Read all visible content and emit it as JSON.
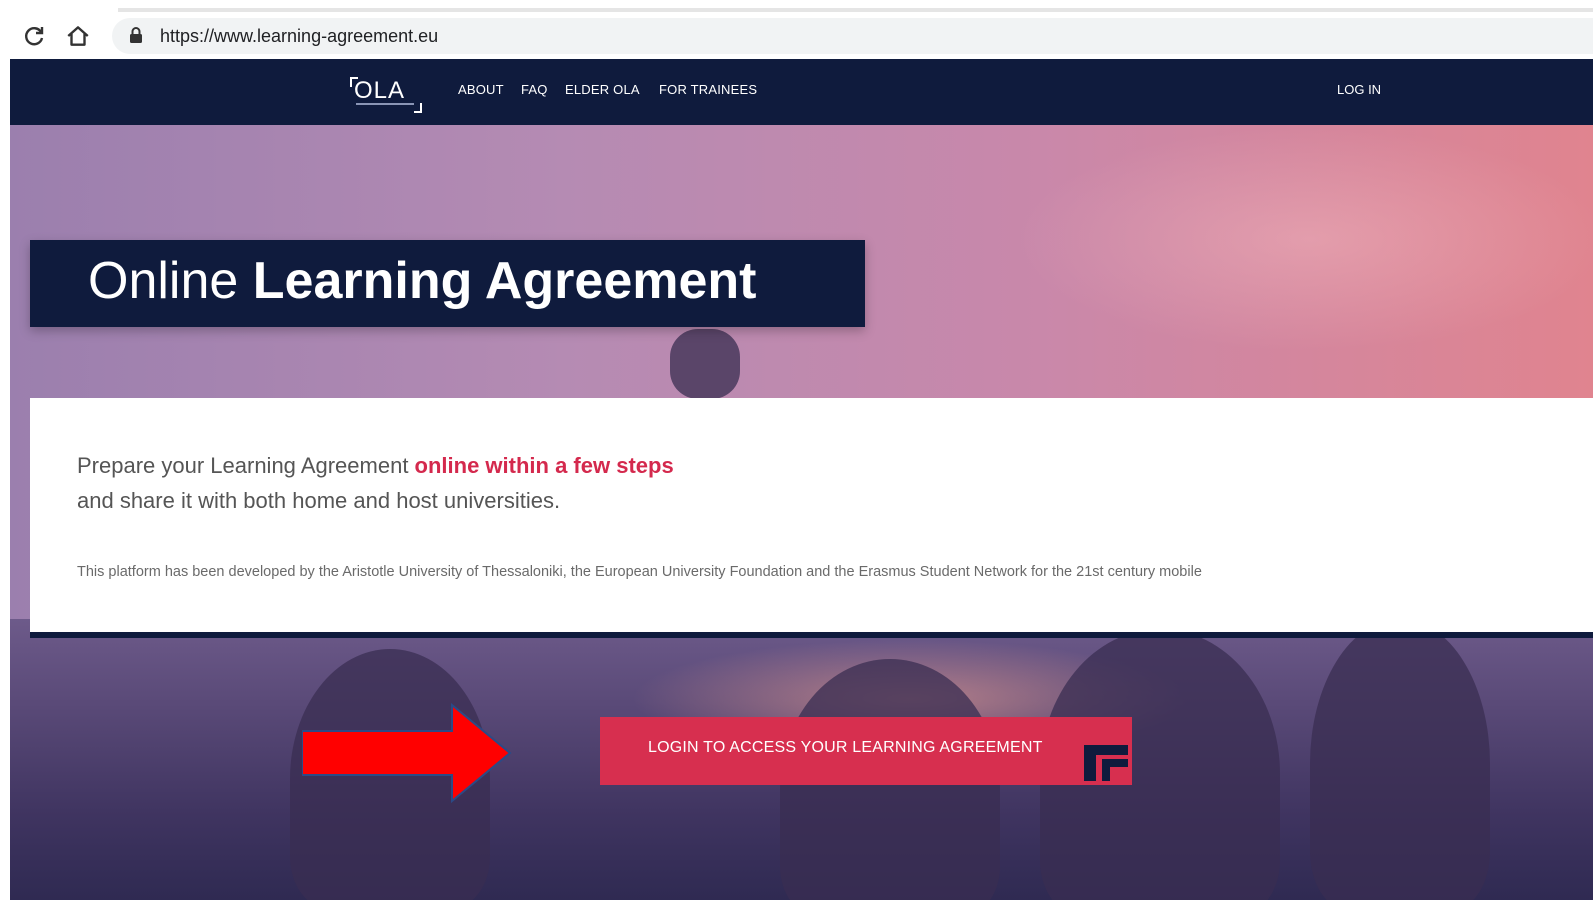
{
  "browser": {
    "url": "https://www.learning-agreement.eu",
    "icons": {
      "reload": "reload-icon",
      "home": "home-icon",
      "lock": "lock-icon"
    }
  },
  "nav": {
    "logo_text": "OLA",
    "items": [
      "ABOUT",
      "FAQ",
      "ELDER OLA",
      "FOR TRAINEES"
    ],
    "login": "LOG IN"
  },
  "hero": {
    "title_light": "Online",
    "title_bold": "Learning Agreement"
  },
  "card": {
    "lead_prefix": "Prepare your Learning Agreement ",
    "lead_highlight": "online within a few steps",
    "lead_line2": "and share it with both home and host universities.",
    "small_text": "This platform has been developed by the Aristotle University of Thessaloniki, the European University Foundation and the Erasmus Student Network for the 21st century mobile"
  },
  "cta": {
    "label": "LOGIN TO ACCESS YOUR LEARNING AGREEMENT",
    "icon": "external-link-icon"
  },
  "colors": {
    "navy": "#0f1b3d",
    "accent_red": "#d72f4f",
    "highlight_red": "#d4294d",
    "annotation_arrow": "#ff0000"
  }
}
